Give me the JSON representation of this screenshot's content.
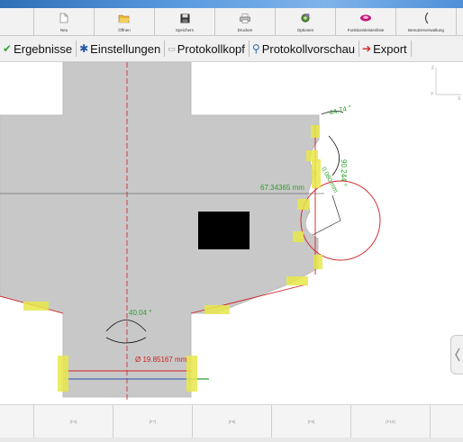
{
  "toolbar": {
    "buttons": [
      {
        "label": "",
        "icon": "partial-icon"
      },
      {
        "label": "Neu",
        "icon": "new-file-icon"
      },
      {
        "label": "Öffnen",
        "icon": "open-folder-icon"
      },
      {
        "label": "Speichern",
        "icon": "save-disk-icon"
      },
      {
        "label": "Drucken",
        "icon": "printer-icon"
      },
      {
        "label": "Optionen",
        "icon": "options-gear-icon"
      },
      {
        "label": "Funktionsleistenliste",
        "icon": "function-list-icon"
      },
      {
        "label": "Benutzerverwaltung",
        "icon": "user-management-icon"
      }
    ]
  },
  "ribbon": {
    "items": [
      {
        "label": "Ergebnisse",
        "icon": "check-icon"
      },
      {
        "label": "Einstellungen",
        "icon": "settings-icon"
      },
      {
        "label": "Protokollkopf",
        "icon": "protocol-header-icon"
      },
      {
        "label": "Protokollvorschau",
        "icon": "magnifier-icon"
      },
      {
        "label": "Export",
        "icon": "export-arrow-icon"
      }
    ]
  },
  "measurements": {
    "angle_top": "44.74 °",
    "angle_right": "90.244 °",
    "radius_small": "0.080 mm",
    "distance": "67.34365 mm",
    "angle_bottom": "40.04 °",
    "diameter": "Ø 19.85167 mm"
  },
  "axes": {
    "y": "Y",
    "x": "X",
    "z": "Z"
  },
  "fkeys": [
    "",
    "[F4]",
    "[F7]",
    "[F8]",
    "[F9]",
    "[F10]",
    ""
  ],
  "colors": {
    "part_fill": "#c8c8c8",
    "measure_green": "#2e9e2e",
    "measure_red": "#d41a1a",
    "highlight": "#e8e84a"
  }
}
